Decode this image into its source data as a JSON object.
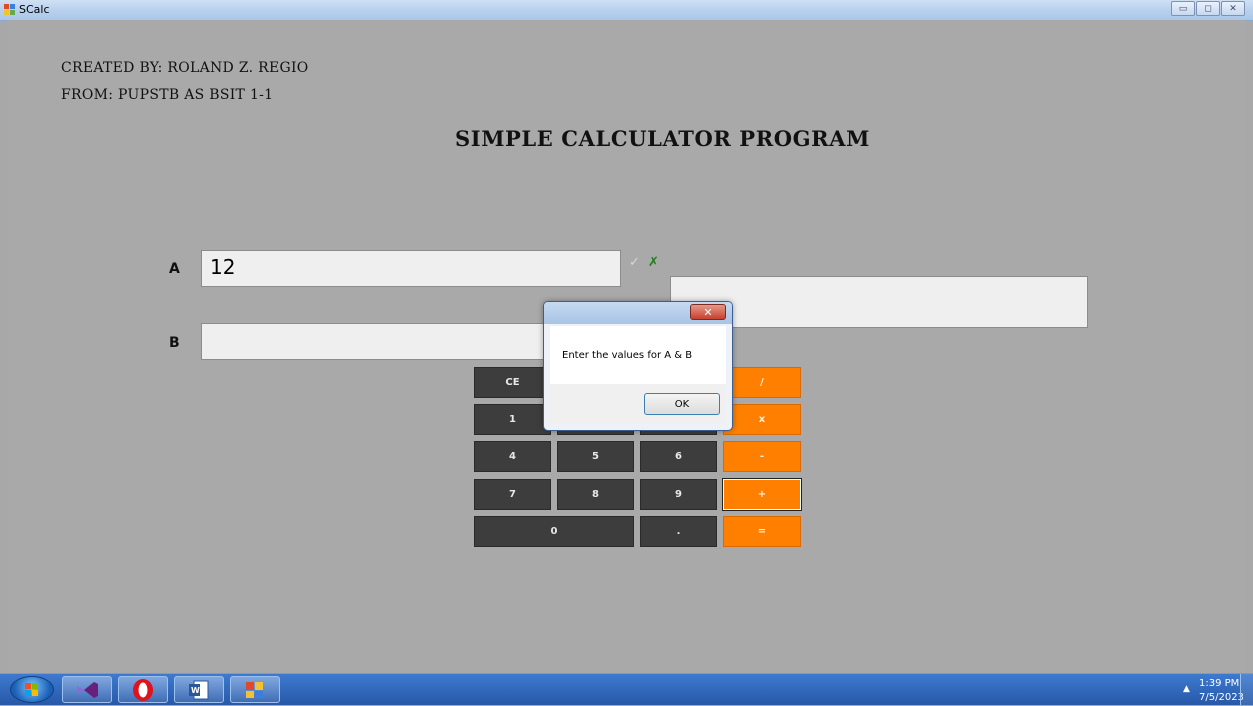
{
  "window": {
    "title": "SCalc",
    "controls": {
      "minimize": "▭",
      "maximize": "◻",
      "close": "✕"
    }
  },
  "header": {
    "created_by": "CREATED BY: ROLAND Z. REGIO",
    "from": "FROM: PUPSTB AS BSIT 1-1",
    "title": "SIMPLE CALCULATOR PROGRAM"
  },
  "inputs": {
    "a_label": "A",
    "a_value": "12",
    "b_label": "B",
    "b_value": "",
    "result_value": "",
    "validation_check": "✓",
    "validation_cross": "✗",
    "colors": {
      "check": "#d8d8d8",
      "cross": "#1f7a1f"
    }
  },
  "keypad": {
    "ce": "CE",
    "one": "1",
    "four": "4",
    "five": "5",
    "six": "6",
    "seven": "7",
    "eight": "8",
    "nine": "9",
    "zero": "0",
    "dot": ".",
    "divide": "/",
    "multiply": "x",
    "subtract": "-",
    "add": "+",
    "equals": "=",
    "colors": {
      "dark": "#3d3d3d",
      "operator": "#ff7f00"
    }
  },
  "dialog": {
    "close_glyph": "✕",
    "message": "Enter the values for A & B",
    "ok_label": "OK"
  },
  "taskbar": {
    "items": [
      "start-orb-icon",
      "visual-studio-icon",
      "opera-icon",
      "word-icon",
      "app-icon"
    ],
    "tray_arrow": "▲",
    "time": "1:39 PM",
    "date": "7/5/2023"
  }
}
